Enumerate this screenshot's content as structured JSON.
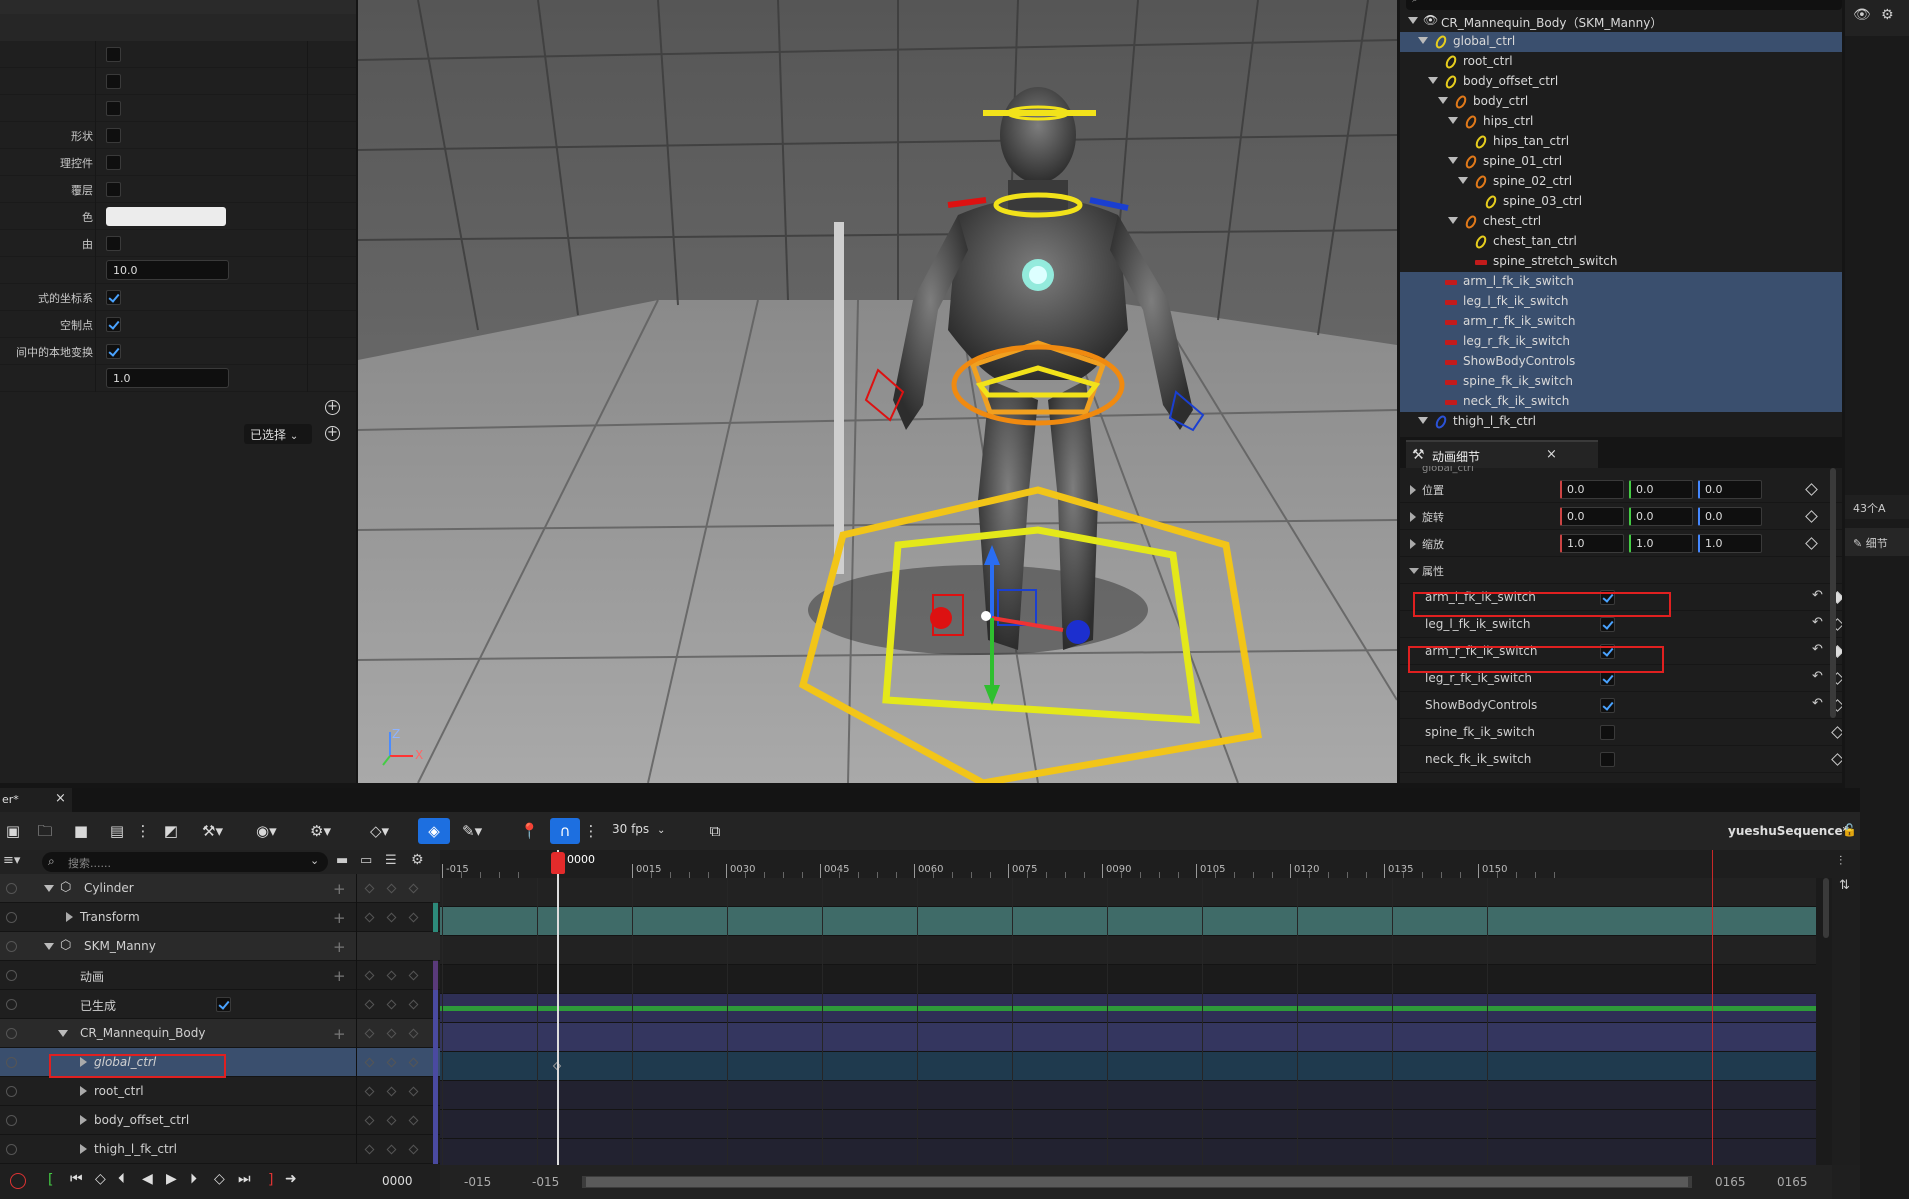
{
  "details": {
    "rows": [
      {
        "label": "",
        "type": "checkbox",
        "checked": false
      },
      {
        "label": "",
        "type": "checkbox",
        "checked": false
      },
      {
        "label": "",
        "type": "checkbox",
        "checked": false
      },
      {
        "label": "形状",
        "type": "checkbox",
        "checked": false
      },
      {
        "label": "理控件",
        "type": "checkbox",
        "checked": false
      },
      {
        "label": "覆层",
        "type": "checkbox",
        "checked": false
      },
      {
        "label": "色",
        "type": "color"
      },
      {
        "label": "由",
        "type": "checkbox",
        "checked": false
      },
      {
        "label": "",
        "type": "number",
        "value": "10.0"
      },
      {
        "label": "式的坐标系",
        "type": "checkbox",
        "checked": true
      },
      {
        "label": "空制点",
        "type": "checkbox",
        "checked": true
      },
      {
        "label": "间中的本地变换",
        "type": "checkbox",
        "checked": true
      },
      {
        "label": "",
        "type": "number",
        "value": "1.0"
      }
    ],
    "selected_dropdown": "已选择"
  },
  "outliner": {
    "search_placeholder": "搜索",
    "items": [
      {
        "label": "CR_Mannequin_Body（SKM_Manny）",
        "indent": 0,
        "icon": "eye",
        "expand": true,
        "sel": false
      },
      {
        "label": "global_ctrl",
        "indent": 1,
        "icon": "ring-yellow",
        "expand": true,
        "sel": true
      },
      {
        "label": "root_ctrl",
        "indent": 2,
        "icon": "ring-yellow",
        "expand": false,
        "sel": false
      },
      {
        "label": "body_offset_ctrl",
        "indent": 2,
        "icon": "ring-yellow",
        "expand": true,
        "sel": false
      },
      {
        "label": "body_ctrl",
        "indent": 3,
        "icon": "ring-orange",
        "expand": true,
        "sel": false
      },
      {
        "label": "hips_ctrl",
        "indent": 4,
        "icon": "ring-orange",
        "expand": true,
        "sel": false
      },
      {
        "label": "hips_tan_ctrl",
        "indent": 5,
        "icon": "ring-yellow",
        "expand": false,
        "sel": false
      },
      {
        "label": "spine_01_ctrl",
        "indent": 4,
        "icon": "ring-orange",
        "expand": true,
        "sel": false
      },
      {
        "label": "spine_02_ctrl",
        "indent": 5,
        "icon": "ring-orange",
        "expand": true,
        "sel": false
      },
      {
        "label": "spine_03_ctrl",
        "indent": 6,
        "icon": "ring-yellow",
        "expand": false,
        "sel": false
      },
      {
        "label": "chest_ctrl",
        "indent": 4,
        "icon": "ring-orange",
        "expand": true,
        "sel": false
      },
      {
        "label": "chest_tan_ctrl",
        "indent": 5,
        "icon": "ring-yellow",
        "expand": false,
        "sel": false
      },
      {
        "label": "spine_stretch_switch",
        "indent": 5,
        "icon": "bar-red",
        "expand": false,
        "sel": false
      },
      {
        "label": "arm_l_fk_ik_switch",
        "indent": 2,
        "icon": "bar-red",
        "expand": false,
        "sel": true
      },
      {
        "label": "leg_l_fk_ik_switch",
        "indent": 2,
        "icon": "bar-red",
        "expand": false,
        "sel": true
      },
      {
        "label": "arm_r_fk_ik_switch",
        "indent": 2,
        "icon": "bar-red",
        "expand": false,
        "sel": true
      },
      {
        "label": "leg_r_fk_ik_switch",
        "indent": 2,
        "icon": "bar-red",
        "expand": false,
        "sel": true
      },
      {
        "label": "ShowBodyControls",
        "indent": 2,
        "icon": "bar-red",
        "expand": false,
        "sel": true
      },
      {
        "label": "spine_fk_ik_switch",
        "indent": 2,
        "icon": "bar-red",
        "expand": false,
        "sel": true
      },
      {
        "label": "neck_fk_ik_switch",
        "indent": 2,
        "icon": "bar-red",
        "expand": false,
        "sel": true
      },
      {
        "label": "thigh_l_fk_ctrl",
        "indent": 1,
        "icon": "ring-blue",
        "expand": true,
        "sel": false
      }
    ]
  },
  "anim_details": {
    "tab_label": "动画细节",
    "subheader": "global_ctrl",
    "transform": [
      {
        "label": "位置",
        "x": "0.0",
        "y": "0.0",
        "z": "0.0"
      },
      {
        "label": "旋转",
        "x": "0.0",
        "y": "0.0",
        "z": "0.0"
      },
      {
        "label": "缩放",
        "x": "1.0",
        "y": "1.0",
        "z": "1.0"
      }
    ],
    "attributes_label": "属性",
    "attributes": [
      {
        "label": "arm_l_fk_ik_switch",
        "checked": true,
        "reset": true,
        "key_filled": true,
        "highlight": true
      },
      {
        "label": "leg_l_fk_ik_switch",
        "checked": true,
        "reset": true,
        "key_filled": false,
        "highlight": false
      },
      {
        "label": "arm_r_fk_ik_switch",
        "checked": true,
        "reset": true,
        "key_filled": true,
        "highlight": true
      },
      {
        "label": "leg_r_fk_ik_switch",
        "checked": true,
        "reset": true,
        "key_filled": false,
        "highlight": false
      },
      {
        "label": "ShowBodyControls",
        "checked": true,
        "reset": true,
        "key_filled": false,
        "highlight": false
      },
      {
        "label": "spine_fk_ik_switch",
        "checked": false,
        "reset": false,
        "key_filled": false,
        "highlight": false
      },
      {
        "label": "neck_fk_ik_switch",
        "checked": false,
        "reset": false,
        "key_filled": false,
        "highlight": false
      }
    ]
  },
  "far_right": {
    "count_text": "43个A",
    "details_tab": "细节"
  },
  "sequencer": {
    "tab_label": "er*",
    "fps": "30 fps",
    "sequence_name": "yueshuSequence*",
    "search_placeholder": "搜索......",
    "current_frame": "0000",
    "ruler_marks": [
      "-015",
      "0015",
      "0030",
      "0045",
      "0060",
      "0075",
      "0090",
      "0105",
      "0120",
      "0135",
      "0150"
    ],
    "tracks": [
      {
        "label": "Cylinder",
        "indent": 0,
        "kind": "actor",
        "expand": true,
        "add": true
      },
      {
        "label": "Transform",
        "indent": 1,
        "kind": "track",
        "expand": false,
        "add": true
      },
      {
        "label": "SKM_Manny",
        "indent": 0,
        "kind": "actor",
        "expand": true,
        "add": true
      },
      {
        "label": "动画",
        "indent": 1,
        "kind": "plain",
        "expand": false,
        "add": true
      },
      {
        "label": "已生成",
        "indent": 1,
        "kind": "checkbox",
        "expand": false,
        "add": false
      },
      {
        "label": "CR_Mannequin_Body",
        "indent": 1,
        "kind": "rig",
        "expand": true,
        "add": true
      },
      {
        "label": "global_ctrl",
        "indent": 2,
        "kind": "control",
        "expand": false,
        "add": false,
        "selected": true
      },
      {
        "label": "root_ctrl",
        "indent": 2,
        "kind": "control",
        "expand": false,
        "add": false
      },
      {
        "label": "body_offset_ctrl",
        "indent": 2,
        "kind": "control",
        "expand": false,
        "add": false
      },
      {
        "label": "thigh_l_fk_ctrl",
        "indent": 2,
        "kind": "control",
        "expand": false,
        "add": false
      }
    ],
    "playback": {
      "frame": "0000",
      "start_a": "-015",
      "start_b": "-015",
      "end_a": "0165",
      "end_b": "0165"
    }
  },
  "viewport": {
    "axis_z": "Z",
    "axis_x": "X"
  }
}
